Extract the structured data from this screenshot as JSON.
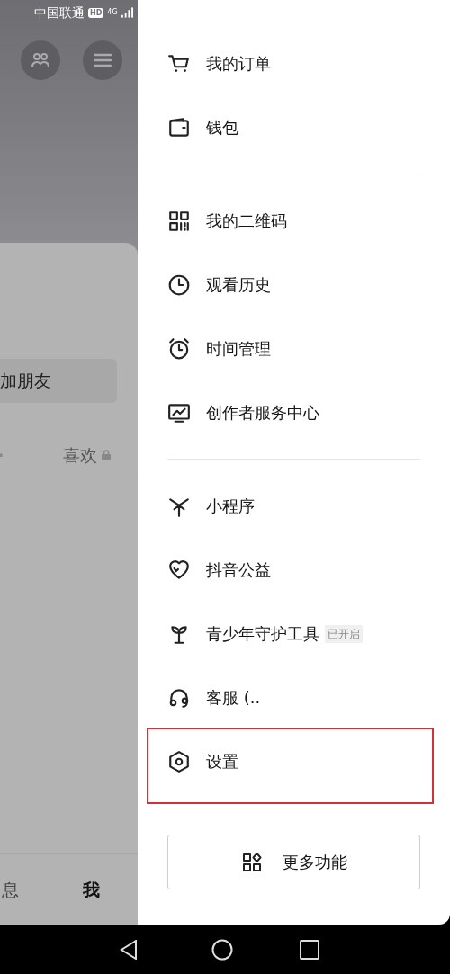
{
  "status_bar": {
    "carrier": "中国联通",
    "hd_badge": "HD",
    "network": "4G"
  },
  "profile_behind": {
    "add_friend_button": "加朋友",
    "tab_liked": "喜欢",
    "bottom_tabs": [
      {
        "label": "息",
        "selected": false
      },
      {
        "label": "我",
        "selected": true
      }
    ]
  },
  "drawer": {
    "groups": [
      [
        {
          "label": "我的订单"
        },
        {
          "label": "钱包"
        }
      ],
      [
        {
          "label": "我的二维码"
        },
        {
          "label": "观看历史"
        },
        {
          "label": "时间管理"
        },
        {
          "label": "创作者服务中心"
        }
      ],
      [
        {
          "label": "小程序",
          "highlighted": false
        },
        {
          "label": "抖音公益",
          "highlighted": false
        },
        {
          "label": "青少年守护工具",
          "badge": "已开启",
          "highlighted": false
        },
        {
          "label": "客服 (..",
          "highlighted": false
        },
        {
          "label": "设置",
          "highlighted": true
        }
      ]
    ],
    "more_button": "更多功能"
  }
}
